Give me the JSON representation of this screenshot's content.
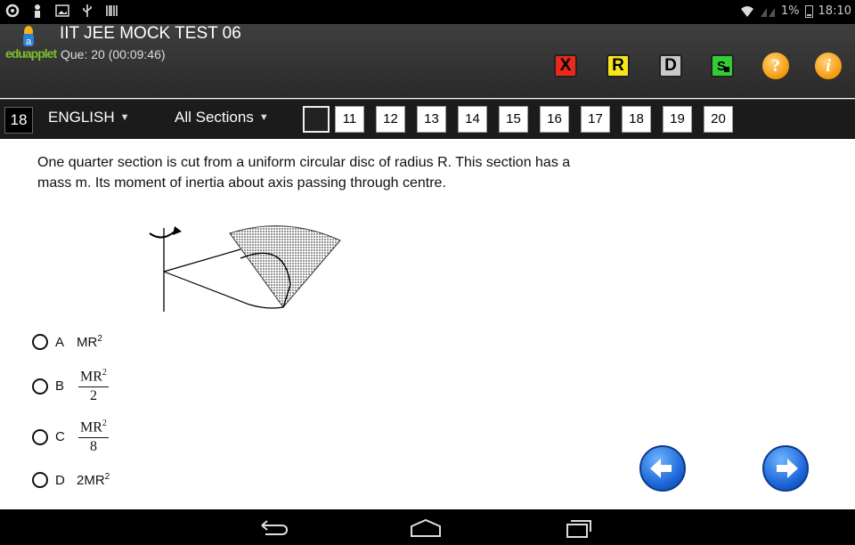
{
  "status_bar": {
    "battery": "1%",
    "time": "18:10"
  },
  "app": {
    "logo_text": "eduapplet",
    "title": "IIT JEE MOCK TEST 06",
    "subtitle": "Que: 20 (00:09:46)",
    "toolbar_buttons": {
      "x": "X",
      "r": "R",
      "d": "D",
      "save_icon": "save-s-icon",
      "help_icon": "question-icon",
      "info": "i"
    },
    "colors": {
      "x_button": "#e8291c",
      "r_button": "#f5e51b",
      "d_button": "#c8c8c8",
      "s_button": "#33cc33"
    }
  },
  "question_bar": {
    "current": "18",
    "language": "ENGLISH",
    "sections": "All Sections",
    "numbers": [
      "11",
      "12",
      "13",
      "14",
      "15",
      "16",
      "17",
      "18",
      "19",
      "20"
    ]
  },
  "question": {
    "text": "One quarter section is cut from a uniform circular disc of radius R. This section has a mass m. Its moment of inertia about axis passing through centre.",
    "options": [
      {
        "letter": "A",
        "base": "MR",
        "exp": "2",
        "coef": ""
      },
      {
        "letter": "B",
        "num_base": "MR",
        "num_exp": "2",
        "den": "2"
      },
      {
        "letter": "C",
        "num_base": "MR",
        "num_exp": "2",
        "den": "8"
      },
      {
        "letter": "D",
        "coef": "2",
        "base": "MR",
        "exp": "2"
      }
    ]
  },
  "navigation": {
    "prev_icon": "arrow-left-icon",
    "next_icon": "arrow-right-icon"
  },
  "system_nav": {
    "back_icon": "back-icon",
    "home_icon": "home-icon",
    "recents_icon": "recents-icon"
  }
}
